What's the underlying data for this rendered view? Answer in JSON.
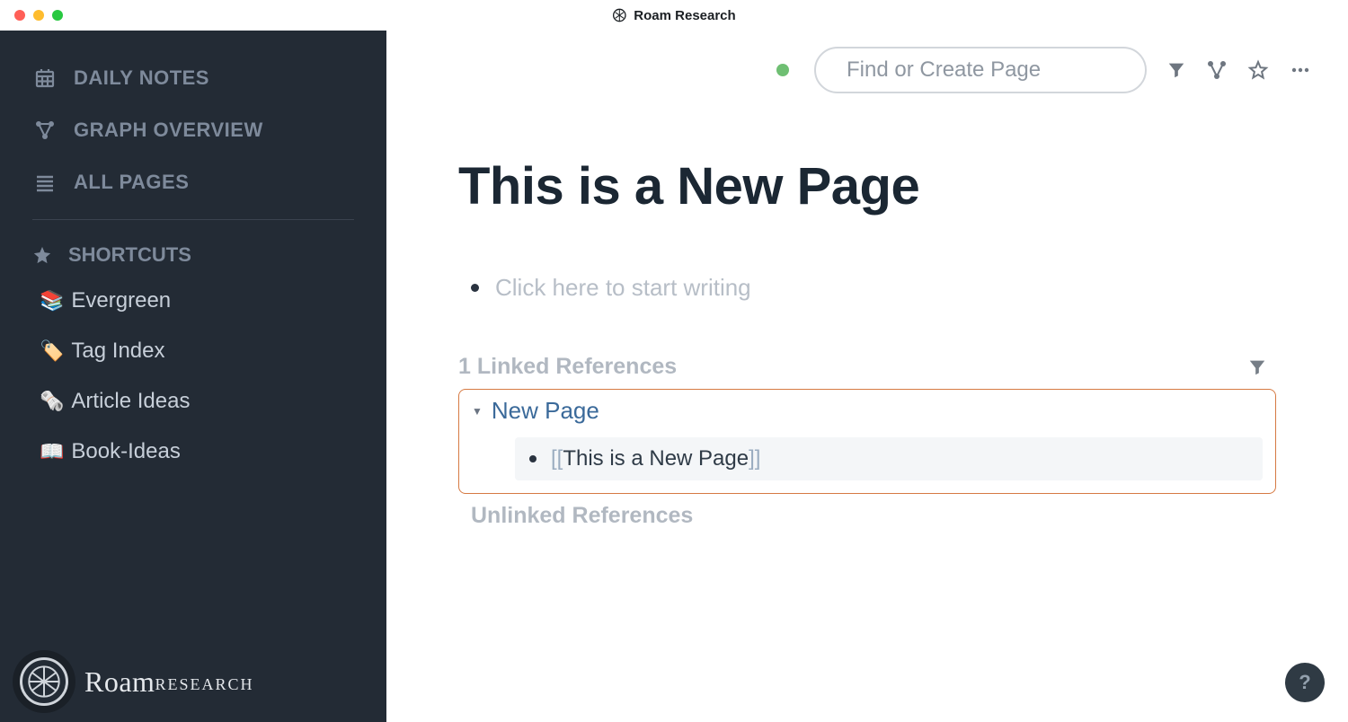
{
  "app": {
    "title": "Roam Research"
  },
  "sidebar": {
    "nav": [
      {
        "label": "DAILY NOTES"
      },
      {
        "label": "GRAPH OVERVIEW"
      },
      {
        "label": "ALL PAGES"
      }
    ],
    "shortcuts_label": "SHORTCUTS",
    "shortcuts": [
      {
        "emoji": "📚",
        "label": "Evergreen"
      },
      {
        "emoji": "🏷️",
        "label": "Tag Index"
      },
      {
        "emoji": "🗞️",
        "label": "Article Ideas"
      },
      {
        "emoji": "📖",
        "label": "Book-Ideas"
      }
    ],
    "brand": {
      "name": "Roam",
      "sub": "RESEARCH"
    }
  },
  "topbar": {
    "search_placeholder": "Find or Create Page"
  },
  "page": {
    "title": "This is a New Page",
    "empty_block_placeholder": "Click here to start writing"
  },
  "refs": {
    "linked_title": "1 Linked References",
    "source_page": "New Page",
    "mention_open": "[[",
    "mention_text": "This is a New Page",
    "mention_close": "]]",
    "unlinked_title": "Unlinked References"
  },
  "help": {
    "label": "?"
  }
}
